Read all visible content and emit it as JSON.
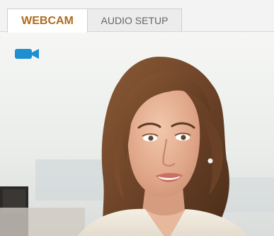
{
  "tabs": {
    "webcam_label": "WEBCAM",
    "audio_label": "AUDIO SETUP",
    "active": "webcam"
  },
  "video": {
    "camera_icon": "video-camera-icon",
    "content": "live webcam feed"
  },
  "colors": {
    "active_tab_text": "#b06b1e",
    "inactive_tab_text": "#666666",
    "camera_icon": "#1f8fd1"
  }
}
